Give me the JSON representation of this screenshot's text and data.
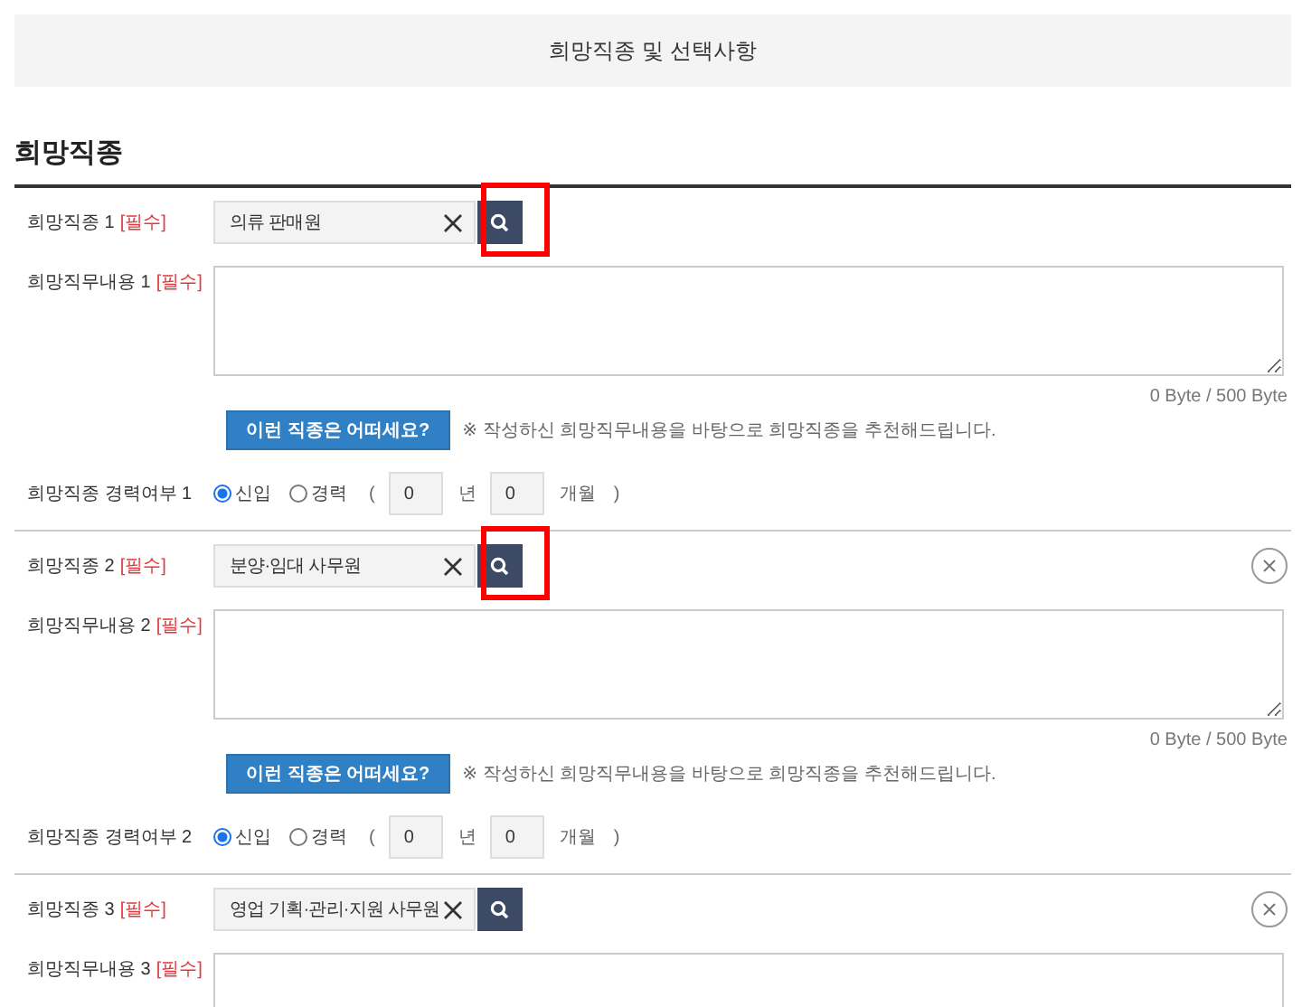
{
  "header": {
    "title": "희망직종 및 선택사항"
  },
  "section_title": "희망직종",
  "entries": [
    {
      "job_label": "희망직종 1",
      "required": "[필수]",
      "job_value": "의류 판매원",
      "highlighted": true,
      "removable": false,
      "desc_label": "희망직무내용 1",
      "desc_required": "[필수]",
      "byte_count": "0 Byte / 500 Byte",
      "suggest_button": "이런 직종은 어떠세요?",
      "suggest_note": "※ 작성하신 희망직무내용을 바탕으로 희망직종을 추천해드립니다.",
      "exp_label": "희망직종 경력여부 1",
      "exp_options": [
        {
          "label": "신입",
          "selected": true
        },
        {
          "label": "경력",
          "selected": false
        }
      ],
      "open_paren": "(",
      "years": "0",
      "years_unit": "년",
      "months": "0",
      "months_unit": "개월",
      "close_paren": ")"
    },
    {
      "job_label": "희망직종 2",
      "required": "[필수]",
      "job_value": "분양·임대 사무원",
      "highlighted": true,
      "removable": true,
      "desc_label": "희망직무내용 2",
      "desc_required": "[필수]",
      "byte_count": "0 Byte / 500 Byte",
      "suggest_button": "이런 직종은 어떠세요?",
      "suggest_note": "※ 작성하신 희망직무내용을 바탕으로 희망직종을 추천해드립니다.",
      "exp_label": "희망직종 경력여부 2",
      "exp_options": [
        {
          "label": "신입",
          "selected": true
        },
        {
          "label": "경력",
          "selected": false
        }
      ],
      "open_paren": "(",
      "years": "0",
      "years_unit": "년",
      "months": "0",
      "months_unit": "개월",
      "close_paren": ")"
    },
    {
      "job_label": "희망직종 3",
      "required": "[필수]",
      "job_value": "영업 기획·관리·지원 사무원",
      "highlighted": false,
      "removable": true,
      "desc_label": "희망직무내용 3",
      "desc_required": "[필수]"
    }
  ]
}
